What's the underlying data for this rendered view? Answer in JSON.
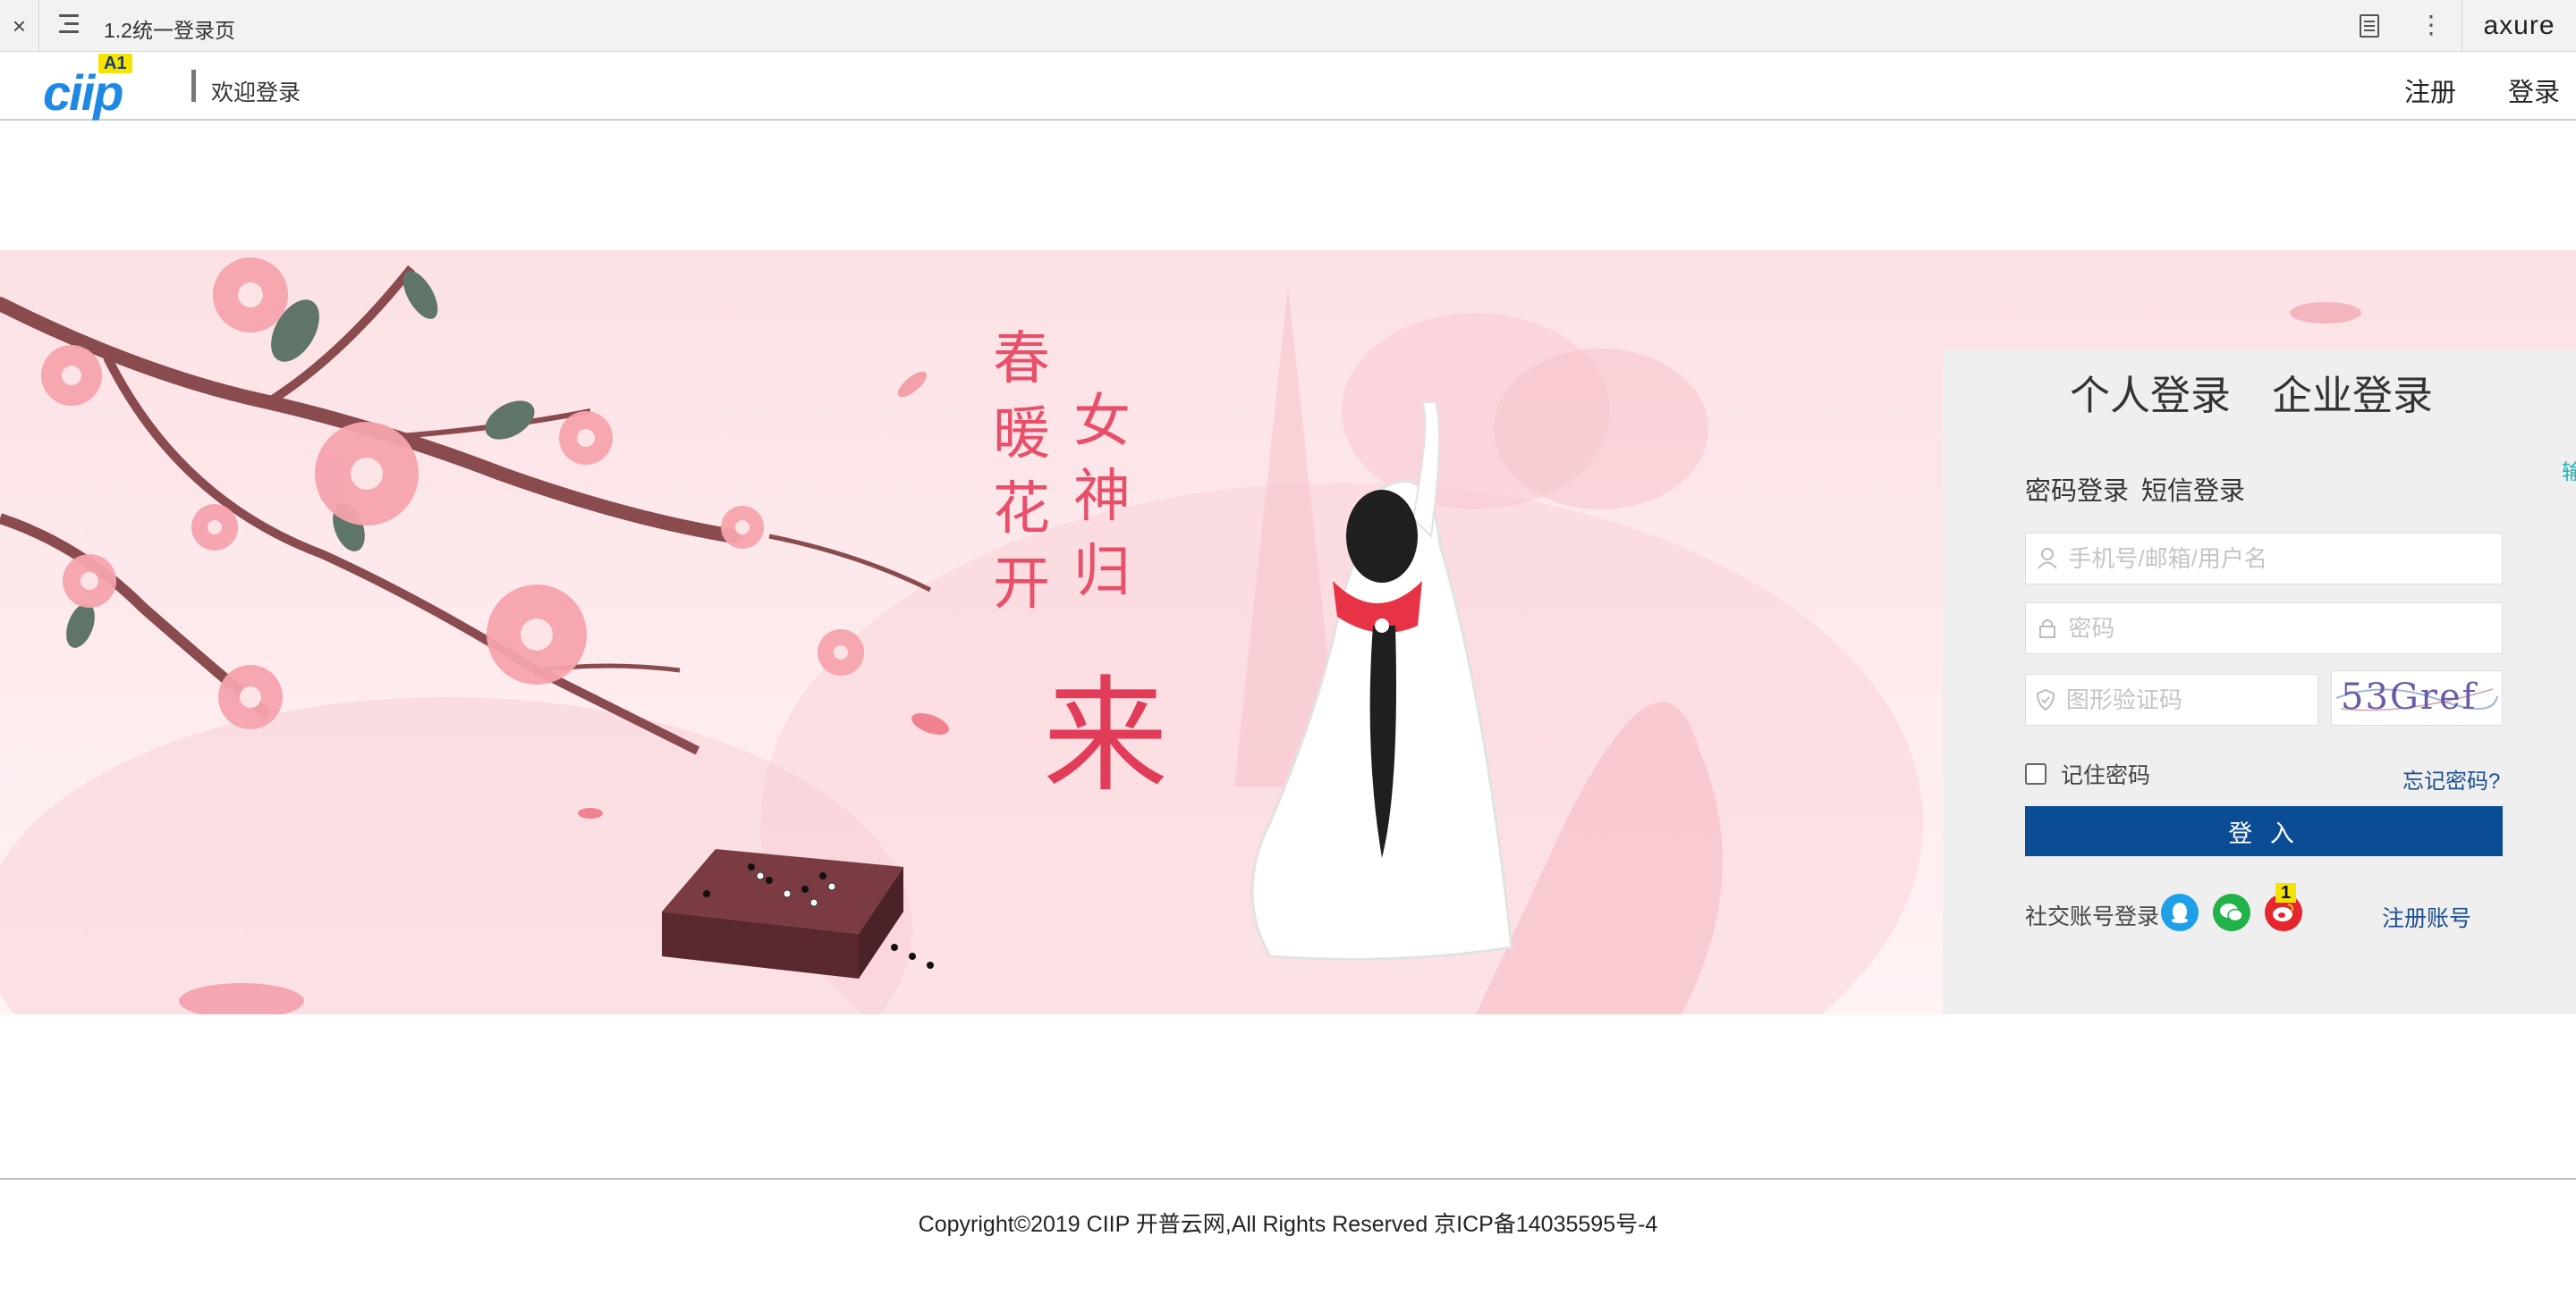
{
  "axure_bar": {
    "close": "×",
    "page_title": "1.2统一登录页",
    "more": "⋮",
    "brand": "axure"
  },
  "header": {
    "logo_text": "ciip",
    "logo_badge": "A1",
    "welcome": "欢迎登录",
    "register_link": "注册",
    "login_link": "登录"
  },
  "banner": {
    "poem_left": "春暖花开",
    "poem_right_top": "女神归",
    "poem_right_big": "来"
  },
  "login_panel": {
    "tabs": [
      "个人登录",
      "企业登录"
    ],
    "subtabs": [
      "密码登录",
      "短信登录"
    ],
    "side_hint": "输",
    "username_placeholder": "手机号/邮箱/用户名",
    "password_placeholder": "密码",
    "captcha_placeholder": "图形验证码",
    "captcha_text": "53Gref",
    "remember_label": "记住密码",
    "forgot_link": "忘记密码?",
    "submit_label": "登 入",
    "social_label": "社交账号登录",
    "social_badge": "1",
    "signup_link": "注册账号",
    "colors": {
      "primary": "#0b4d94",
      "qq": "#1e9fe8",
      "wechat": "#21b24a",
      "weibo": "#e6262e"
    }
  },
  "footer": {
    "copyright": "Copyright©2019 CIIP 开普云网,All Rights Reserved 京ICP备14035595号-4"
  }
}
